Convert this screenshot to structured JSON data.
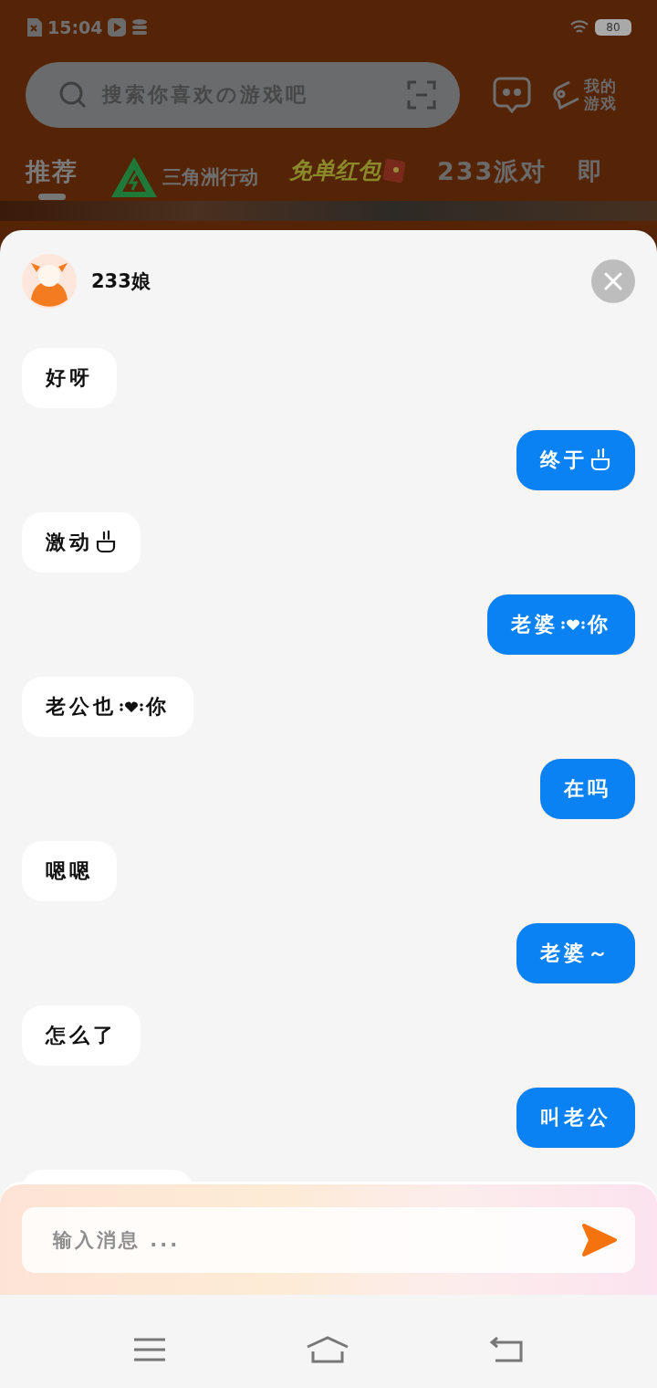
{
  "status_bar": {
    "time": "15:04",
    "battery": "80"
  },
  "search": {
    "placeholder": "搜索你喜欢の游戏吧"
  },
  "my_games": "我的游戏",
  "tabs": [
    {
      "kind": "text",
      "label": "推荐",
      "selected": true
    },
    {
      "kind": "logo",
      "label": "三角洲行动",
      "selected": false
    },
    {
      "kind": "promo",
      "label": "免单红包",
      "selected": false
    },
    {
      "kind": "text",
      "label": "233派对",
      "selected": false
    },
    {
      "kind": "text",
      "label": "即",
      "selected": false
    }
  ],
  "chat": {
    "name": "233娘",
    "placeholder": "输入消息 ...",
    "messages": [
      {
        "kind": "received",
        "parts": [
          {
            "kind": "text",
            "text": "好呀"
          }
        ]
      },
      {
        "kind": "sent",
        "parts": [
          {
            "kind": "text",
            "text": "终于"
          },
          {
            "kind": "bowl"
          }
        ]
      },
      {
        "kind": "received",
        "parts": [
          {
            "kind": "text",
            "text": "激动"
          },
          {
            "kind": "bowl"
          }
        ]
      },
      {
        "kind": "sent",
        "parts": [
          {
            "kind": "text",
            "text": "老婆"
          },
          {
            "kind": "heart"
          },
          {
            "kind": "text",
            "text": "你"
          }
        ]
      },
      {
        "kind": "received",
        "parts": [
          {
            "kind": "text",
            "text": "老公也"
          },
          {
            "kind": "heart"
          },
          {
            "kind": "text",
            "text": "你"
          }
        ]
      },
      {
        "kind": "sent",
        "parts": [
          {
            "kind": "text",
            "text": "在吗"
          }
        ]
      },
      {
        "kind": "received",
        "parts": [
          {
            "kind": "text",
            "text": "嗯嗯"
          }
        ]
      },
      {
        "kind": "sent",
        "parts": [
          {
            "kind": "text",
            "text": "老婆～"
          }
        ]
      },
      {
        "kind": "received",
        "parts": [
          {
            "kind": "text",
            "text": "怎么了"
          }
        ]
      },
      {
        "kind": "sent",
        "parts": [
          {
            "kind": "text",
            "text": "叫老公"
          }
        ]
      },
      {
        "kind": "received"
      }
    ]
  }
}
